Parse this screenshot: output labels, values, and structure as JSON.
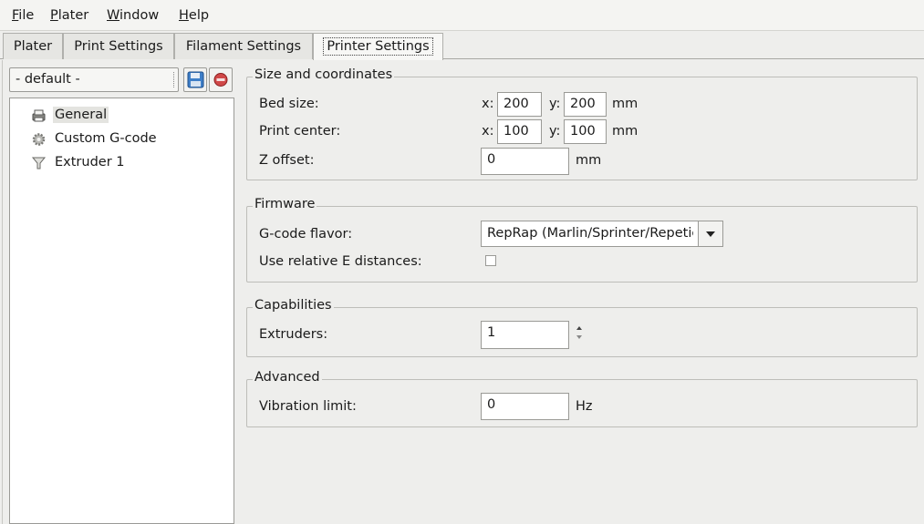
{
  "menubar": [
    {
      "underline": "F",
      "rest": "ile"
    },
    {
      "underline": "P",
      "rest": "later"
    },
    {
      "underline": "W",
      "rest": "indow"
    },
    {
      "underline": "H",
      "rest": "elp"
    }
  ],
  "tabs": [
    "Plater",
    "Print Settings",
    "Filament Settings",
    "Printer Settings"
  ],
  "active_tab": "Printer Settings",
  "preset": {
    "selected": "- default -"
  },
  "tree": {
    "items": [
      {
        "label": "General",
        "icon": "printer-icon",
        "selected": true
      },
      {
        "label": "Custom G-code",
        "icon": "cog-icon",
        "selected": false
      },
      {
        "label": "Extruder 1",
        "icon": "funnel-icon",
        "selected": false
      }
    ]
  },
  "size_coords": {
    "title": "Size and coordinates",
    "bed_size": {
      "label": "Bed size:",
      "x_label": "x:",
      "x": "200",
      "y_label": "y:",
      "y": "200",
      "unit": "mm"
    },
    "print_center": {
      "label": "Print center:",
      "x_label": "x:",
      "x": "100",
      "y_label": "y:",
      "y": "100",
      "unit": "mm"
    },
    "z_offset": {
      "label": "Z offset:",
      "value": "0",
      "unit": "mm"
    }
  },
  "firmware": {
    "title": "Firmware",
    "gcode_flavor": {
      "label": "G-code flavor:",
      "value": "RepRap (Marlin/Sprinter/Repetier)"
    },
    "relative_e": {
      "label": "Use relative E distances:",
      "checked": false
    }
  },
  "capabilities": {
    "title": "Capabilities",
    "extruders": {
      "label": "Extruders:",
      "value": "1"
    }
  },
  "advanced": {
    "title": "Advanced",
    "vibration_limit": {
      "label": "Vibration limit:",
      "value": "0",
      "unit": "Hz"
    }
  }
}
